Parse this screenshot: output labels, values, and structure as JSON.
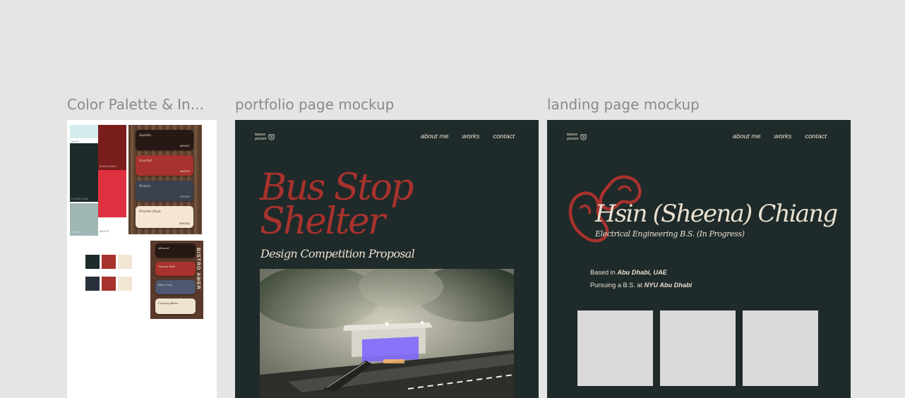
{
  "frames": {
    "palette": {
      "label": "Color Palette & In...",
      "swatch_labels": [
        "WISP",
        "BURGUNDY",
        "CHARCOAL",
        "SLATE",
        "WHITE"
      ],
      "cards": [
        {
          "name": "Saddle",
          "hex": "#6F4E37"
        },
        {
          "name": "Scarlet",
          "hex": "#B22222"
        },
        {
          "name": "Rodon",
          "hex": "#2F4F4F"
        },
        {
          "name": "Prairie Dust",
          "hex": "#F5E6D3"
        }
      ],
      "cards2": [
        {
          "name": "Almond"
        },
        {
          "name": "Tuscan Red"
        },
        {
          "name": "Blue Grey"
        },
        {
          "name": "Creamy Blanc"
        }
      ],
      "vertical_text": "BISTRO AMER",
      "colors": {
        "wisp": "#d4ecec",
        "charcoal": "#1f2a2a",
        "burgundy": "#7a1d1d",
        "red": "#e03140",
        "slate": "#9fb6b4",
        "scarlet": "#a8322d",
        "navy": "#2a2f3d",
        "cream": "#f2e5d3"
      }
    },
    "portfolio": {
      "label": "portfolio page mockup",
      "brand": [
        "beenz",
        "pocket"
      ],
      "nav": [
        "about me",
        "works",
        "contact"
      ],
      "title_line1": "Bus Stop",
      "title_line2": "Shelter",
      "subtitle": "Design Competition Proposal"
    },
    "landing": {
      "label": "landing page mockup",
      "brand": [
        "beenz",
        "pocket"
      ],
      "nav": [
        "about me",
        "works",
        "contact"
      ],
      "name": "Hsin (Sheena) Chiang",
      "degree": "Electrical Engineering B.S. (In Progress)",
      "based_prefix": "Based in ",
      "based_place": "Abu Dhabi, UAE",
      "pursuing_prefix": "Pursuing a B.S. at ",
      "pursuing_place": "NYU Abu Dhabi"
    }
  },
  "theme": {
    "background": "#1f2a2a",
    "accent": "#a8322d",
    "text": "#e9e1d0",
    "tile": "#d9d9d9"
  }
}
